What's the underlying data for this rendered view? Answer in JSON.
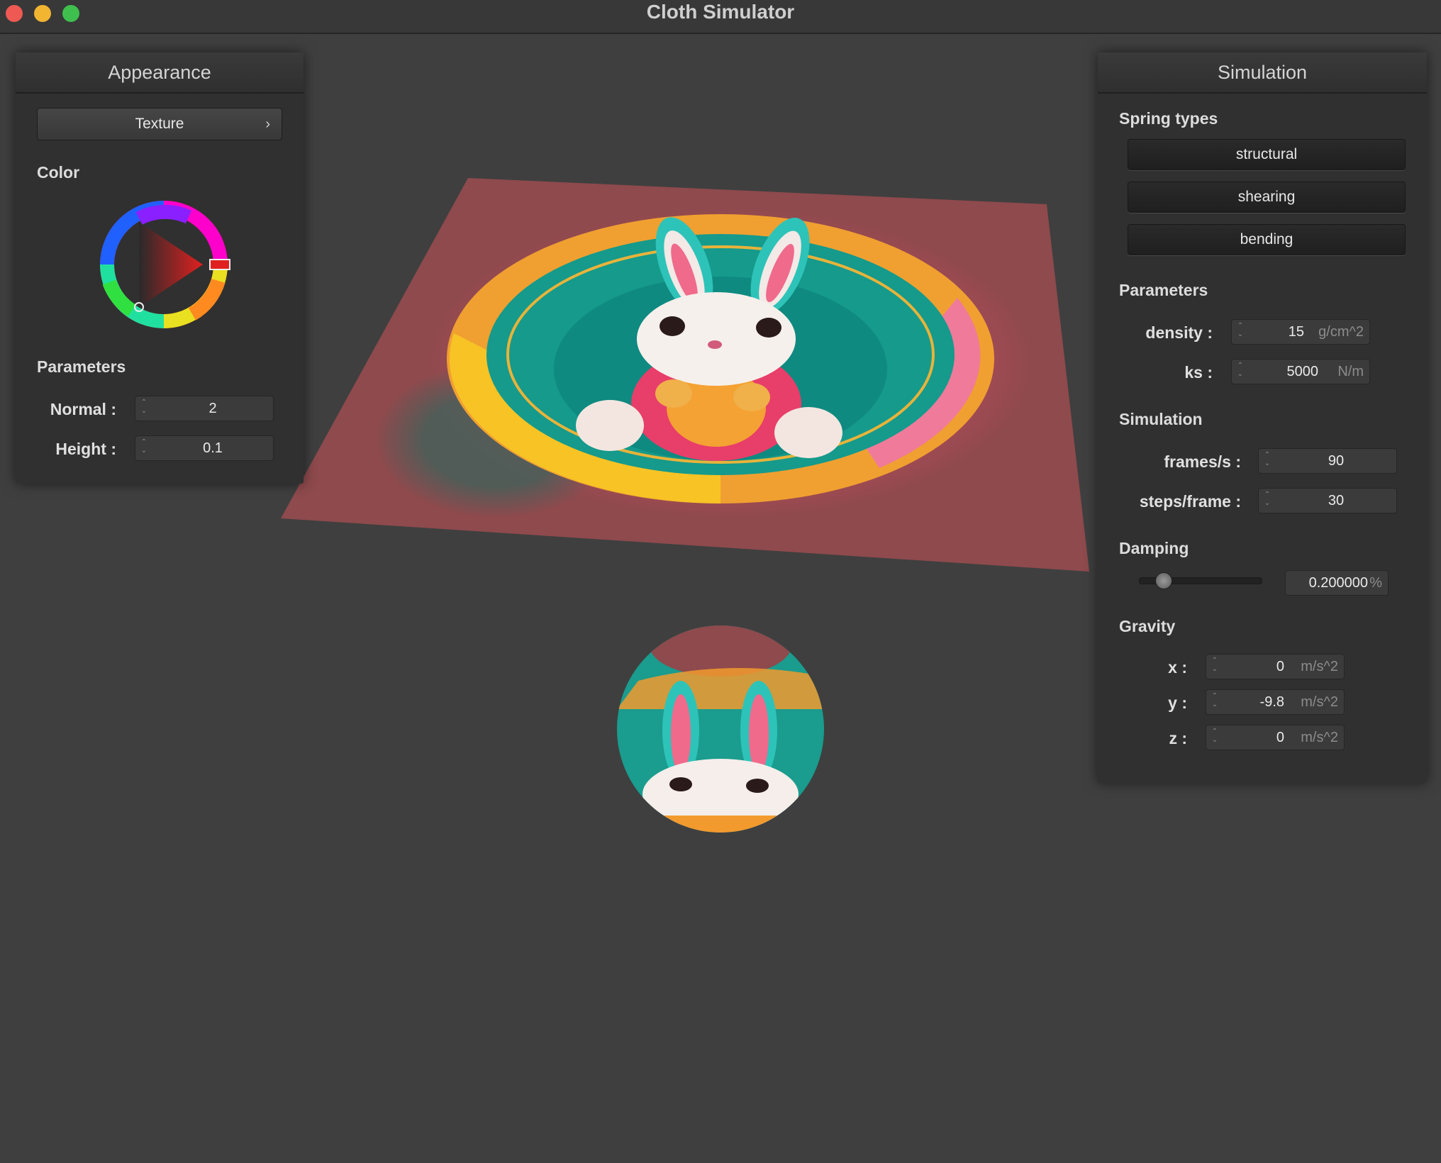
{
  "window": {
    "title": "Cloth Simulator"
  },
  "appearance": {
    "header": "Appearance",
    "texture_button": "Texture",
    "texture_chevron": "›",
    "color_label": "Color",
    "selected_color": "#e02020",
    "parameters_label": "Parameters",
    "normal_label": "Normal :",
    "normal_value": "2",
    "height_label": "Height :",
    "height_value": "0.1"
  },
  "simulation": {
    "header": "Simulation",
    "spring_types_label": "Spring types",
    "spring_types": [
      "structural",
      "shearing",
      "bending"
    ],
    "parameters_label": "Parameters",
    "density_label": "density :",
    "density_value": "15",
    "density_unit": "g/cm^2",
    "ks_label": "ks :",
    "ks_value": "5000",
    "ks_unit": "N/m",
    "simulation_label": "Simulation",
    "fps_label": "frames/s :",
    "fps_value": "90",
    "steps_label": "steps/frame :",
    "steps_value": "30",
    "damping_label": "Damping",
    "damping_value": "0.200000",
    "damping_unit": "%",
    "damping_slider_fraction": 0.2,
    "gravity_label": "Gravity",
    "gx_label": "x :",
    "gx_value": "0",
    "gy_label": "y :",
    "gy_value": "-9.8",
    "gz_label": "z :",
    "gz_value": "0",
    "gravity_unit": "m/s^2"
  },
  "scene": {
    "cloth_color": "#8e4a4d",
    "sphere_color": "#8e4a4d"
  }
}
